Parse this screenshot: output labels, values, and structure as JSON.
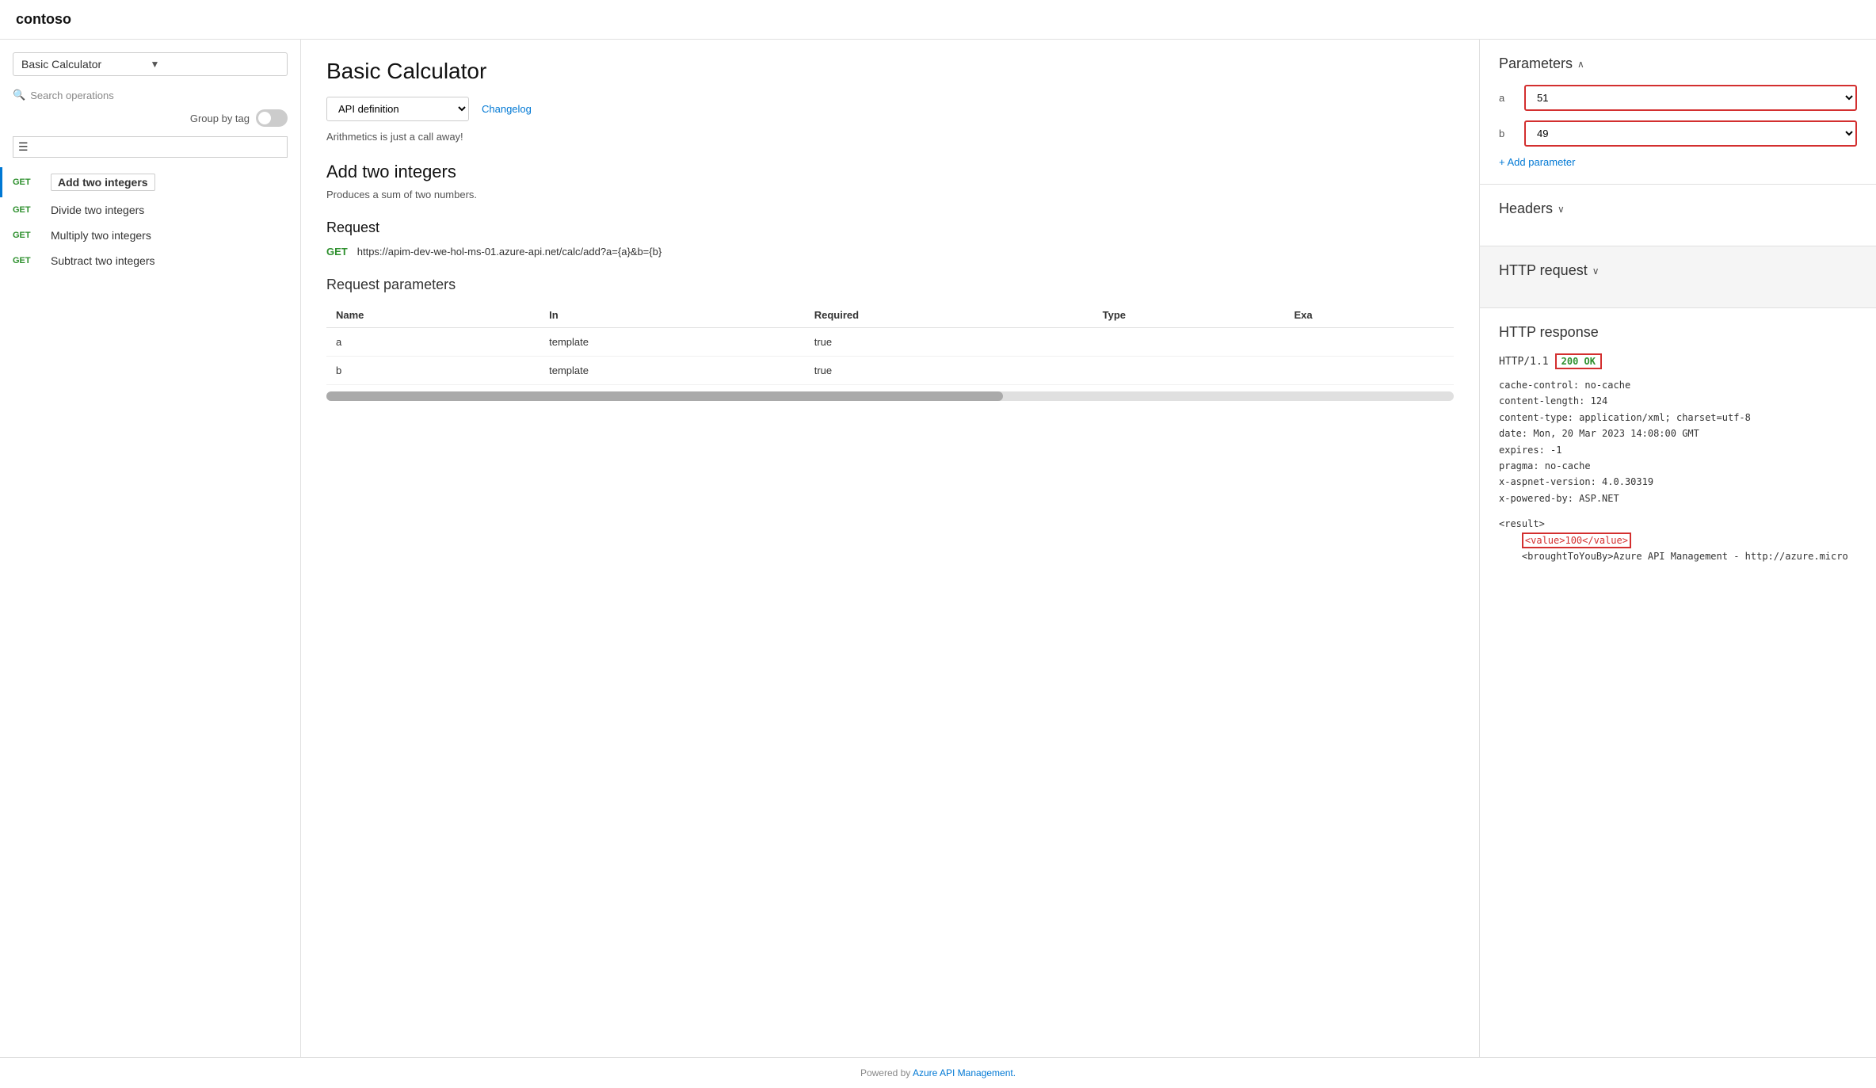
{
  "topbar": {
    "logo": "contoso"
  },
  "sidebar": {
    "dropdown_label": "Basic Calculator",
    "search_placeholder": "Search operations",
    "group_by_tag_label": "Group by tag",
    "operations": [
      {
        "id": "add",
        "method": "GET",
        "label": "Add two integers",
        "active": true
      },
      {
        "id": "divide",
        "method": "GET",
        "label": "Divide two integers",
        "active": false
      },
      {
        "id": "multiply",
        "method": "GET",
        "label": "Multiply two integers",
        "active": false
      },
      {
        "id": "subtract",
        "method": "GET",
        "label": "Subtract two integers",
        "active": false
      }
    ]
  },
  "main": {
    "page_title": "Basic Calculator",
    "api_def_options": [
      "API definition"
    ],
    "api_def_selected": "API definition",
    "changelog_label": "Changelog",
    "api_description": "Arithmetics is just a call away!",
    "operation_title": "Add two integers",
    "operation_description": "Produces a sum of two numbers.",
    "request_section": "Request",
    "request_method": "GET",
    "request_url": "https://apim-dev-we-hol-ms-01.azure-api.net/calc/add?a={a}&b={b}",
    "request_params_title": "Request parameters",
    "params_table": {
      "headers": [
        "Name",
        "In",
        "Required",
        "Type",
        "Exa"
      ],
      "rows": [
        {
          "name": "a",
          "in": "template",
          "required": "true",
          "type": ""
        },
        {
          "name": "b",
          "in": "template",
          "required": "true",
          "type": ""
        }
      ]
    }
  },
  "right_panel": {
    "parameters_title": "Parameters",
    "param_a_label": "a",
    "param_a_value": "51",
    "param_b_label": "b",
    "param_b_value": "49",
    "add_param_label": "+ Add parameter",
    "headers_title": "Headers",
    "http_request_title": "HTTP request",
    "http_response_title": "HTTP response",
    "http_version": "HTTP/1.1",
    "status_code": "200 OK",
    "response_headers": [
      "cache-control: no-cache",
      "content-length: 124",
      "content-type: application/xml; charset=utf-8",
      "date: Mon, 20 Mar 2023 14:08:00 GMT",
      "expires: -1",
      "pragma: no-cache",
      "x-aspnet-version: 4.0.30319",
      "x-powered-by: ASP.NET"
    ],
    "response_body_pre": "<result>",
    "response_body_value": "<value>100</value>",
    "response_body_post": "    <broughtToYouBy>Azure API Management - http://azure.micro"
  },
  "footer": {
    "text": "Powered by ",
    "link_text": "Azure API Management.",
    "link_url": "#"
  }
}
